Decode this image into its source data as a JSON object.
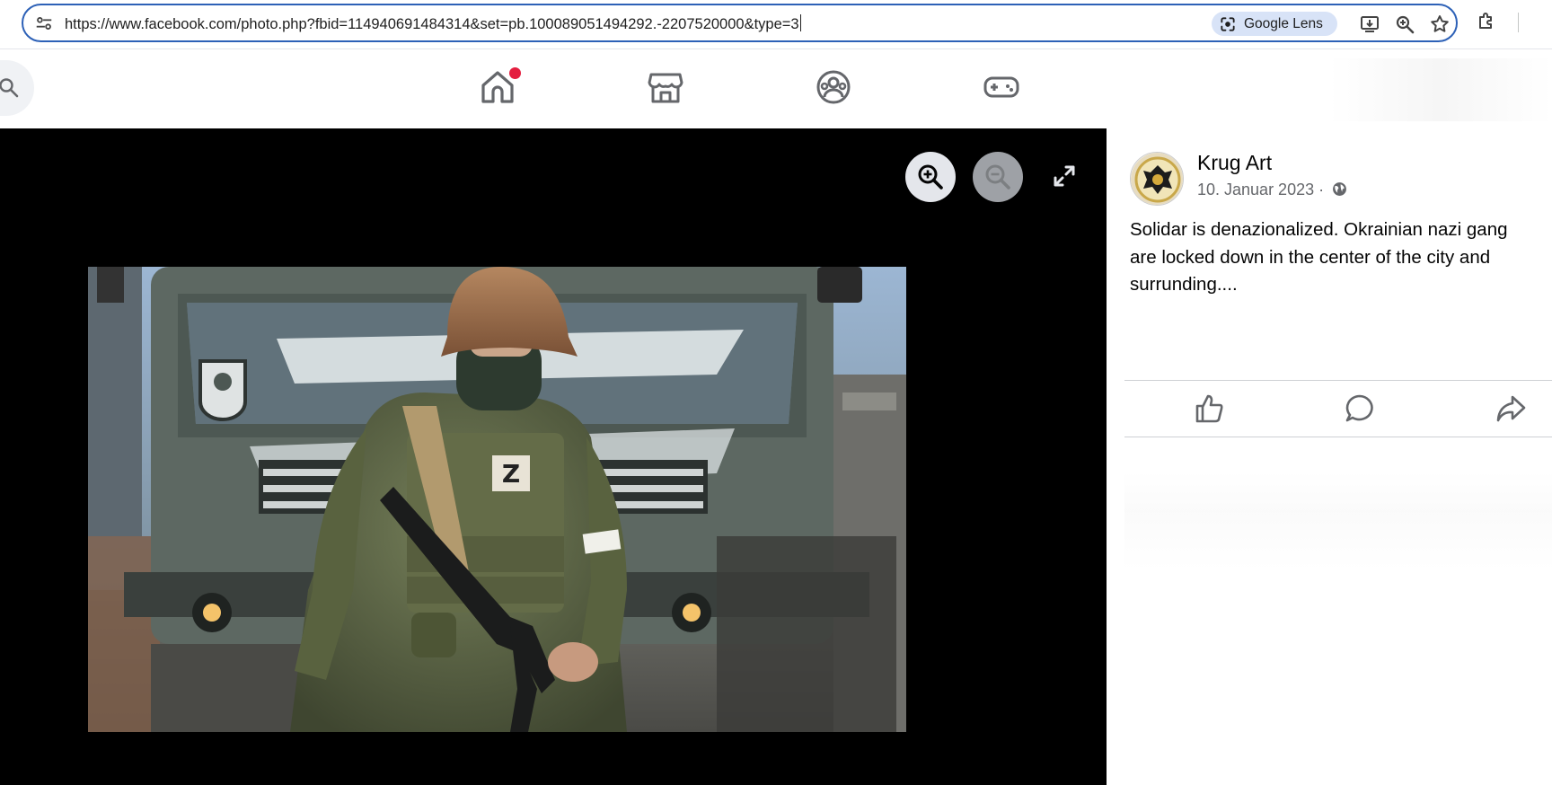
{
  "browser": {
    "url": "https://www.facebook.com/photo.php?fbid=114940691484314&set=pb.100089051494292.-2207520000&type=3",
    "lens_label": "Google Lens",
    "icons": [
      "tune-icon",
      "google-lens-icon",
      "install-app-icon",
      "zoom-icon",
      "bookmark-star-icon",
      "extensions-icon"
    ]
  },
  "nav": {
    "icons": [
      "search-icon",
      "home-icon",
      "marketplace-icon",
      "groups-icon",
      "gaming-icon"
    ],
    "home_has_notification": true
  },
  "viewer": {
    "icons": [
      "zoom-in-icon",
      "zoom-out-icon",
      "fullscreen-icon"
    ],
    "zoom_out_disabled": true,
    "patch_letter": "Z"
  },
  "post": {
    "author": "Krug Art",
    "date": "10. Januar 2023",
    "separator": "·",
    "audience_icon": "globe-icon",
    "text_lines": [
      "Solidar is denazionalized. Okrainian nazi gang",
      "are locked down in the center of the city and",
      "surrunding...."
    ],
    "actions": [
      "like-icon",
      "comment-icon",
      "share-icon"
    ]
  },
  "colors": {
    "omnibox_border": "#2d61b7",
    "lens_bg": "#d8e3f7",
    "notification": "#e41e3f",
    "viewer_bg": "#000000"
  }
}
